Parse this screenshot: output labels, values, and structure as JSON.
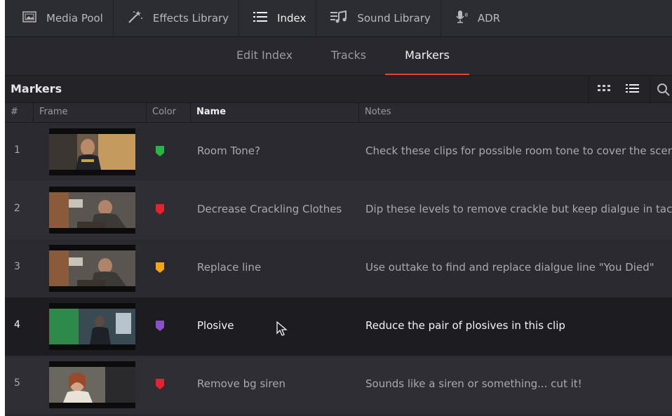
{
  "toolbar": {
    "items": [
      {
        "label": "Media Pool",
        "icon": "media-pool-icon"
      },
      {
        "label": "Effects Library",
        "icon": "effects-wand-icon"
      },
      {
        "label": "Index",
        "icon": "index-list-icon"
      },
      {
        "label": "Sound Library",
        "icon": "sound-library-icon"
      },
      {
        "label": "ADR",
        "icon": "microphone-icon"
      }
    ],
    "active": "Index"
  },
  "subtabs": {
    "items": [
      "Edit Index",
      "Tracks",
      "Markers"
    ],
    "active": "Markers",
    "accent_color": "#e0492e"
  },
  "panel": {
    "title": "Markers",
    "icons": [
      "grid-view-icon",
      "list-view-icon",
      "search-icon"
    ]
  },
  "columns": {
    "num": "#",
    "frame": "Frame",
    "color": "Color",
    "name": "Name",
    "notes": "Notes"
  },
  "markers": [
    {
      "num": "1",
      "color": "#2bb34a",
      "name": "Room Tone?",
      "notes": "Check these clips for possible room tone to cover the scene"
    },
    {
      "num": "2",
      "color": "#e5232f",
      "name": "Decrease Crackling Clothes",
      "notes": "Dip these levels to remove crackle but keep dialgue in tact."
    },
    {
      "num": "3",
      "color": "#f3a712",
      "name": "Replace line",
      "notes": "Use outtake to find and replace dialgue line \"You Died\""
    },
    {
      "num": "4",
      "color": "#8b50c8",
      "name": "Plosive",
      "notes": "Reduce the pair of plosives in this clip",
      "selected": true
    },
    {
      "num": "5",
      "color": "#e5232f",
      "name": "Remove bg siren",
      "notes": "Sounds like a siren or something... cut it!"
    }
  ]
}
